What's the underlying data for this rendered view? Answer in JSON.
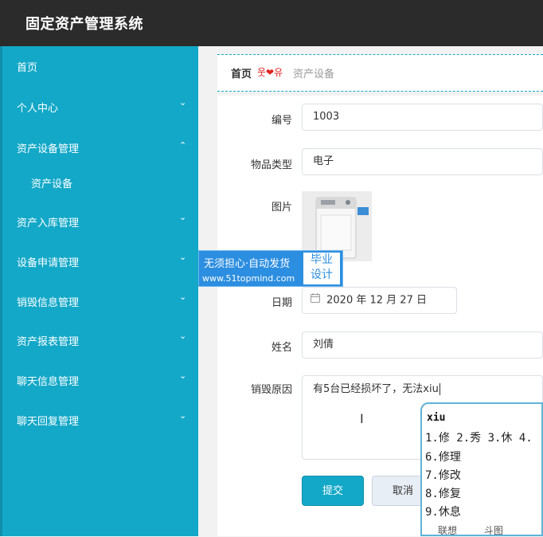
{
  "app": {
    "title": "固定资产管理系统"
  },
  "sidebar": {
    "items": [
      {
        "label": "首页",
        "chevron": ""
      },
      {
        "label": "个人中心",
        "chevron": "⌄"
      },
      {
        "label": "资产设备管理",
        "chevron": "⌃"
      },
      {
        "label": "资产设备",
        "chevron": ""
      },
      {
        "label": "资产入库管理",
        "chevron": "⌄"
      },
      {
        "label": "设备申请管理",
        "chevron": "⌄"
      },
      {
        "label": "销毁信息管理",
        "chevron": "⌄"
      },
      {
        "label": "资产报表管理",
        "chevron": "⌄"
      },
      {
        "label": "聊天信息管理",
        "chevron": "⌄"
      },
      {
        "label": "聊天回复管理",
        "chevron": "⌄"
      }
    ]
  },
  "breadcrumb": {
    "home": "首页",
    "decoration": "웃❤유",
    "current": "资产设备"
  },
  "form": {
    "id_label": "编号",
    "id_value": "1003",
    "type_label": "物品类型",
    "type_value": "电子",
    "image_label": "图片",
    "date_label": "日期",
    "date_value": "2020 年 12 月 27 日",
    "name_label": "姓名",
    "name_value": "刘倩",
    "reason_label": "销毁原因",
    "reason_value": "有5台已经损坏了，无法xiu"
  },
  "buttons": {
    "submit": "提交",
    "cancel": "取消"
  },
  "watermark": {
    "line1": "无须担心·自动发货",
    "line2": "www.51topmind.com",
    "badge_line1": "毕业",
    "badge_line2": "设计"
  },
  "ime": {
    "pinyin": "xiu",
    "row1": "1.修 2.秀 3.休 4.",
    "candidates": [
      "6.修理",
      "7.修改",
      "8.修复",
      "9.休息"
    ],
    "footer_left": "联想",
    "footer_right": "斗图"
  },
  "icons": {
    "calendar": "calendar-icon",
    "chevron": "chevron-icon"
  },
  "colors": {
    "sidebar": "#13a8c8",
    "topbar": "#2b2b2b",
    "primary": "#13a8c8"
  }
}
